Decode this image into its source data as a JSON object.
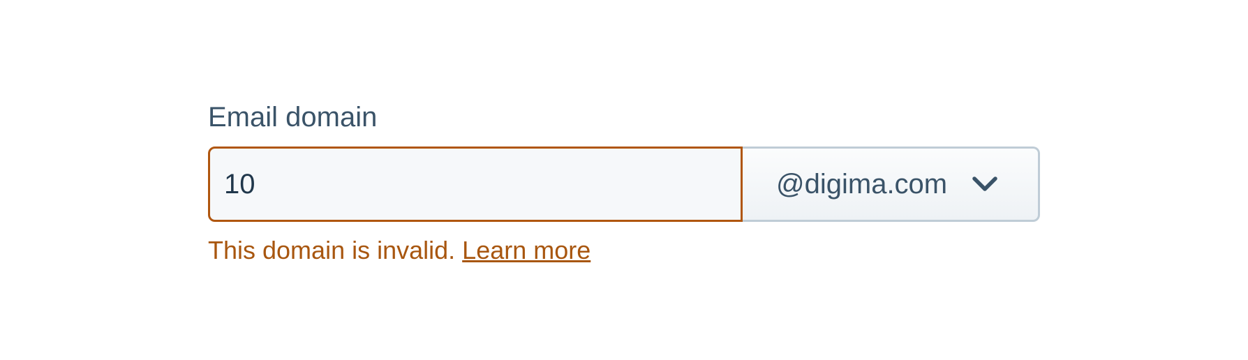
{
  "field": {
    "label": "Email domain",
    "value": "10",
    "domain_select": {
      "selected": "@digima.com",
      "icon": "chevron-down-icon"
    },
    "error": {
      "message": "This domain is invalid.",
      "link_label": "Learn more"
    }
  },
  "colors": {
    "error": "#a8560f",
    "label": "#3a5368",
    "input_bg": "#f6f8fa",
    "select_border": "#bfccd6"
  }
}
